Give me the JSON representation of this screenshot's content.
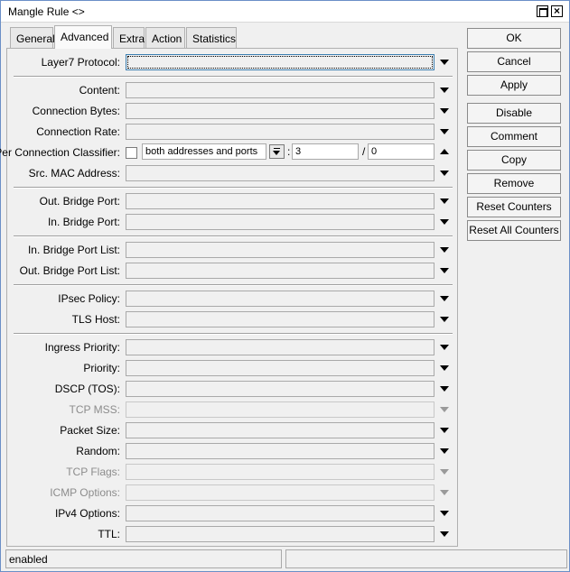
{
  "window": {
    "title": "Mangle Rule <>"
  },
  "tabs": [
    {
      "label": "General"
    },
    {
      "label": "Advanced"
    },
    {
      "label": "Extra"
    },
    {
      "label": "Action"
    },
    {
      "label": "Statistics"
    }
  ],
  "active_tab": "Advanced",
  "fields": {
    "layer7_protocol": {
      "label": "Layer7 Protocol:",
      "value": ""
    },
    "content": {
      "label": "Content:",
      "value": ""
    },
    "connection_bytes": {
      "label": "Connection Bytes:",
      "value": ""
    },
    "connection_rate": {
      "label": "Connection Rate:",
      "value": ""
    },
    "per_connection_classifier": {
      "label": "Per Connection Classifier:",
      "mode": "both addresses and ports",
      "sep1": ":",
      "every": "3",
      "sep2": "/",
      "offset": "0"
    },
    "src_mac_address": {
      "label": "Src. MAC Address:",
      "value": ""
    },
    "out_bridge_port": {
      "label": "Out. Bridge Port:",
      "value": ""
    },
    "in_bridge_port": {
      "label": "In. Bridge Port:",
      "value": ""
    },
    "in_bridge_port_list": {
      "label": "In. Bridge Port List:",
      "value": ""
    },
    "out_bridge_port_list": {
      "label": "Out. Bridge Port List:",
      "value": ""
    },
    "ipsec_policy": {
      "label": "IPsec Policy:",
      "value": ""
    },
    "tls_host": {
      "label": "TLS Host:",
      "value": ""
    },
    "ingress_priority": {
      "label": "Ingress Priority:",
      "value": ""
    },
    "priority": {
      "label": "Priority:",
      "value": ""
    },
    "dscp": {
      "label": "DSCP (TOS):",
      "value": ""
    },
    "tcp_mss": {
      "label": "TCP MSS:",
      "value": "",
      "disabled": true
    },
    "packet_size": {
      "label": "Packet Size:",
      "value": ""
    },
    "random": {
      "label": "Random:",
      "value": ""
    },
    "tcp_flags": {
      "label": "TCP Flags:",
      "value": "",
      "disabled": true
    },
    "icmp_options": {
      "label": "ICMP Options:",
      "value": "",
      "disabled": true
    },
    "ipv4_options": {
      "label": "IPv4 Options:",
      "value": ""
    },
    "ttl": {
      "label": "TTL:",
      "value": ""
    }
  },
  "buttons": {
    "ok": "OK",
    "cancel": "Cancel",
    "apply": "Apply",
    "disable": "Disable",
    "comment": "Comment",
    "copy": "Copy",
    "remove": "Remove",
    "reset_counters": "Reset Counters",
    "reset_all_counters": "Reset All Counters"
  },
  "status": {
    "left": "enabled",
    "right": ""
  }
}
